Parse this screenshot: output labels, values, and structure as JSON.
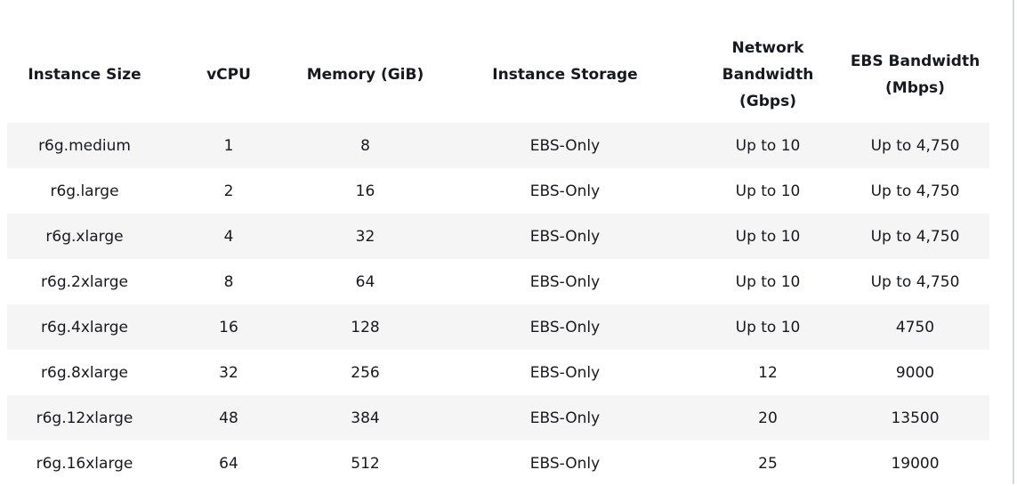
{
  "table": {
    "headers": [
      "Instance Size",
      "vCPU",
      "Memory (GiB)",
      "Instance Storage",
      "Network Bandwidth (Gbps)",
      "EBS Bandwidth (Mbps)"
    ],
    "header_lines": [
      [
        "Instance Size"
      ],
      [
        "vCPU"
      ],
      [
        "Memory (GiB)"
      ],
      [
        "Instance Storage"
      ],
      [
        "Network",
        "Bandwidth",
        "(Gbps)"
      ],
      [
        "EBS Bandwidth",
        "(Mbps)"
      ]
    ],
    "rows": [
      [
        "r6g.medium",
        "1",
        "8",
        "EBS-Only",
        "Up to 10",
        "Up to 4,750"
      ],
      [
        "r6g.large",
        "2",
        "16",
        "EBS-Only",
        "Up to 10",
        "Up to 4,750"
      ],
      [
        "r6g.xlarge",
        "4",
        "32",
        "EBS-Only",
        "Up to 10",
        "Up to 4,750"
      ],
      [
        "r6g.2xlarge",
        "8",
        "64",
        "EBS-Only",
        "Up to 10",
        "Up to 4,750"
      ],
      [
        "r6g.4xlarge",
        "16",
        "128",
        "EBS-Only",
        "Up to 10",
        "4750"
      ],
      [
        "r6g.8xlarge",
        "32",
        "256",
        "EBS-Only",
        "12",
        "9000"
      ],
      [
        "r6g.12xlarge",
        "48",
        "384",
        "EBS-Only",
        "20",
        "13500"
      ],
      [
        "r6g.16xlarge",
        "64",
        "512",
        "EBS-Only",
        "25",
        "19000"
      ]
    ]
  }
}
